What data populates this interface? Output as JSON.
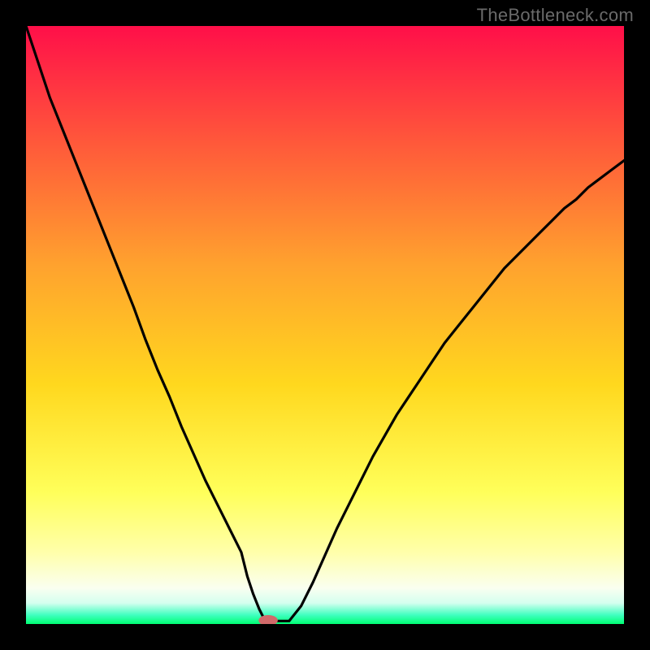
{
  "watermark_text": "TheBottleneck.com",
  "chart_data": {
    "type": "line",
    "title": "",
    "xlabel": "",
    "ylabel": "",
    "xlim": [
      0,
      100
    ],
    "ylim": [
      0,
      100
    ],
    "x": [
      0,
      2,
      4,
      6,
      8,
      10,
      12,
      14,
      16,
      18,
      20,
      22,
      24,
      26,
      28,
      30,
      32,
      34,
      36,
      37,
      38,
      39,
      40,
      42,
      44,
      46,
      48,
      50,
      52,
      54,
      56,
      58,
      60,
      62,
      64,
      66,
      68,
      70,
      72,
      74,
      76,
      78,
      80,
      82,
      84,
      86,
      88,
      90,
      92,
      94,
      96,
      98,
      100
    ],
    "y": [
      100,
      94,
      88,
      83,
      78,
      73,
      68,
      63,
      58,
      53,
      47.5,
      42.5,
      38,
      33,
      28.5,
      24,
      20,
      16,
      12,
      8,
      5,
      2.5,
      0.5,
      0.5,
      0.5,
      3,
      7,
      11.5,
      16,
      20,
      24,
      28,
      31.5,
      35,
      38,
      41,
      44,
      47,
      49.5,
      52,
      54.5,
      57,
      59.5,
      61.5,
      63.5,
      65.5,
      67.5,
      69.5,
      71,
      73,
      74.5,
      76,
      77.5
    ],
    "gradient_stops": [
      {
        "offset": 0.0,
        "color": "#ff0f49"
      },
      {
        "offset": 0.2,
        "color": "#ff5a3a"
      },
      {
        "offset": 0.4,
        "color": "#ffa22e"
      },
      {
        "offset": 0.6,
        "color": "#ffd81e"
      },
      {
        "offset": 0.78,
        "color": "#ffff5a"
      },
      {
        "offset": 0.88,
        "color": "#ffffaa"
      },
      {
        "offset": 0.94,
        "color": "#fafff0"
      },
      {
        "offset": 0.965,
        "color": "#d4ffef"
      },
      {
        "offset": 0.985,
        "color": "#3fffbf"
      },
      {
        "offset": 1.0,
        "color": "#00ff73"
      }
    ],
    "marker": {
      "x": 40.5,
      "y": 0.6,
      "rx": 1.6,
      "ry": 0.9,
      "fill": "#d16a6a"
    }
  }
}
